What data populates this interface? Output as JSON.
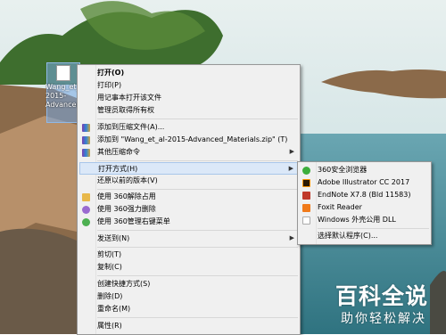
{
  "desktop": {
    "file_icon_label": "Wang_et_al-2015-Advanced_Materials"
  },
  "context_menu": {
    "items": [
      {
        "label": "打开(O)"
      },
      {
        "label": "打印(P)"
      },
      {
        "label": "用记事本打开该文件"
      },
      {
        "label": "管理员取得所有权"
      },
      {
        "label": "添加到压缩文件(A)..."
      },
      {
        "label": "添加到 \"Wang_et_al-2015-Advanced_Materials.zip\" (T)"
      },
      {
        "label": "其他压缩命令"
      },
      {
        "label": "打开方式(H)"
      },
      {
        "label": "还原以前的版本(V)"
      },
      {
        "label": "使用 360解除占用"
      },
      {
        "label": "使用 360强力删除"
      },
      {
        "label": "使用 360管理右键菜单"
      },
      {
        "label": "发送到(N)"
      },
      {
        "label": "剪切(T)"
      },
      {
        "label": "复制(C)"
      },
      {
        "label": "创建快捷方式(S)"
      },
      {
        "label": "删除(D)"
      },
      {
        "label": "重命名(M)"
      },
      {
        "label": "属性(R)"
      }
    ]
  },
  "open_with_menu": {
    "items": [
      {
        "label": "360安全浏览器",
        "icon": "browser-360-icon",
        "color": "#3cae3c"
      },
      {
        "label": "Adobe Illustrator CC 2017",
        "icon": "illustrator-icon",
        "color": "#2b1a04"
      },
      {
        "label": "EndNote X7.8 (Bld 11583)",
        "icon": "endnote-icon",
        "color": "#c0392b"
      },
      {
        "label": "Foxit Reader",
        "icon": "foxit-icon",
        "color": "#f07a1a"
      },
      {
        "label": "Windows 外壳公用 DLL",
        "icon": "shell-dll-icon",
        "color": "#ffffff"
      },
      {
        "label": "选择默认程序(C)..."
      }
    ]
  },
  "watermark": {
    "title": "百科全说",
    "subtitle": "助你轻松解决"
  }
}
